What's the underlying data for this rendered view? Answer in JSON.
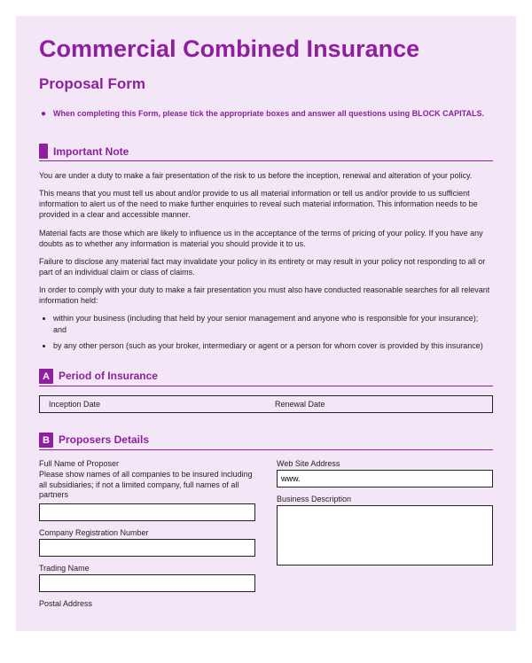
{
  "title": "Commercial Combined Insurance",
  "subtitle": "Proposal Form",
  "instruction": "When completing this Form, please tick the appropriate boxes and answer all questions using BLOCK CAPITALS.",
  "important_note": {
    "heading": "Important Note",
    "p1": "You are under a duty to make a fair presentation of the risk to us before the inception, renewal and alteration of your policy.",
    "p2": "This means that you must tell us about and/or provide to us all material information or tell us and/or provide to us sufficient information to alert us of the need to make further enquiries to reveal such material information. This information needs to be provided in a clear and accessible manner.",
    "p3": "Material facts are those which are likely to influence us in the acceptance of the terms of pricing of your policy. If you have any doubts as to whether any information is material you should provide it to us.",
    "p4": "Failure to disclose any material fact may invalidate your policy in its entirety or may result in your policy not responding to all or part of an individual claim or class of claims.",
    "p5": "In order to comply with your duty to make a fair presentation you must also have conducted reasonable searches for all relevant information held:",
    "b1": "within your business (including that held by your senior management and anyone who is responsible for your insurance); and",
    "b2": "by any other person (such as your broker, intermediary or agent or a person for whom cover is provided by this insurance)"
  },
  "section_a": {
    "letter": "A",
    "title": "Period of Insurance",
    "inception_label": "Inception Date",
    "renewal_label": "Renewal Date"
  },
  "section_b": {
    "letter": "B",
    "title": "Proposers Details",
    "fullname_label": "Full Name of Proposer",
    "fullname_sub": "Please show names of all companies to be insured including all subsidiaries; if not a limited company, full names of all partners",
    "company_reg_label": "Company Registration Number",
    "trading_label": "Trading Name",
    "postal_label": "Postal Address",
    "website_label": "Web Site Address",
    "website_value": "www.",
    "business_desc_label": "Business Description"
  }
}
